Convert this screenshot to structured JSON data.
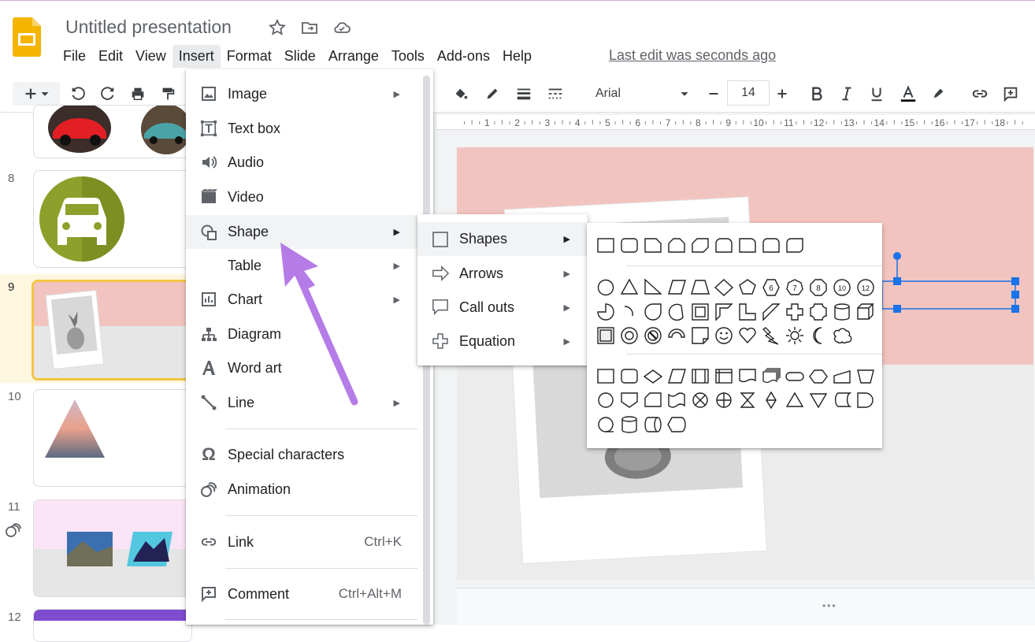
{
  "app": {
    "title": "Untitled presentation",
    "last_edit": "Last edit was seconds ago",
    "menu": [
      "File",
      "Edit",
      "View",
      "Insert",
      "Format",
      "Slide",
      "Arrange",
      "Tools",
      "Add-ons",
      "Help"
    ],
    "active_menu": "Insert"
  },
  "toolbar": {
    "font_name": "Arial",
    "font_size": "14"
  },
  "ruler": {
    "ticks": [
      "1",
      "2",
      "3",
      "4",
      "5",
      "6",
      "7",
      "8",
      "9",
      "10",
      "11",
      "12",
      "13",
      "14",
      "15",
      "16",
      "17",
      "18"
    ]
  },
  "filmstrip": {
    "slide_numbers": [
      "8",
      "9",
      "10",
      "11",
      "12"
    ],
    "selected": "9"
  },
  "insert_menu": {
    "items": [
      {
        "label": "Image",
        "icon": "image-icon",
        "submenu": true
      },
      {
        "label": "Text box",
        "icon": "text-box-icon",
        "submenu": false
      },
      {
        "label": "Audio",
        "icon": "audio-icon",
        "submenu": false
      },
      {
        "label": "Video",
        "icon": "video-icon",
        "submenu": false
      },
      {
        "label": "Shape",
        "icon": "shape-icon",
        "submenu": true
      },
      {
        "label": "Table",
        "icon": "",
        "submenu": true
      },
      {
        "label": "Chart",
        "icon": "chart-icon",
        "submenu": true
      },
      {
        "label": "Diagram",
        "icon": "diagram-icon",
        "submenu": false
      },
      {
        "label": "Word art",
        "icon": "word-art-icon",
        "submenu": false
      },
      {
        "label": "Line",
        "icon": "line-icon",
        "submenu": true
      },
      {
        "label": "Special characters",
        "icon": "omega-icon",
        "submenu": false
      },
      {
        "label": "Animation",
        "icon": "animation-icon",
        "submenu": false
      },
      {
        "label": "Link",
        "icon": "link-icon",
        "shortcut": "Ctrl+K"
      },
      {
        "label": "Comment",
        "icon": "comment-icon",
        "shortcut": "Ctrl+Alt+M"
      }
    ]
  },
  "shape_submenu": {
    "items": [
      {
        "label": "Shapes",
        "icon": "square-icon"
      },
      {
        "label": "Arrows",
        "icon": "arrow-right-icon"
      },
      {
        "label": "Call outs",
        "icon": "callout-icon"
      },
      {
        "label": "Equation",
        "icon": "plus-icon"
      }
    ]
  },
  "colors": {
    "accent": "#1a73e8",
    "menu_highlight": "#f1f3f4",
    "slide_pink": "#f2c4c0",
    "selected_thumb": "#fde293",
    "annotation_arrow": "#b57be6"
  }
}
